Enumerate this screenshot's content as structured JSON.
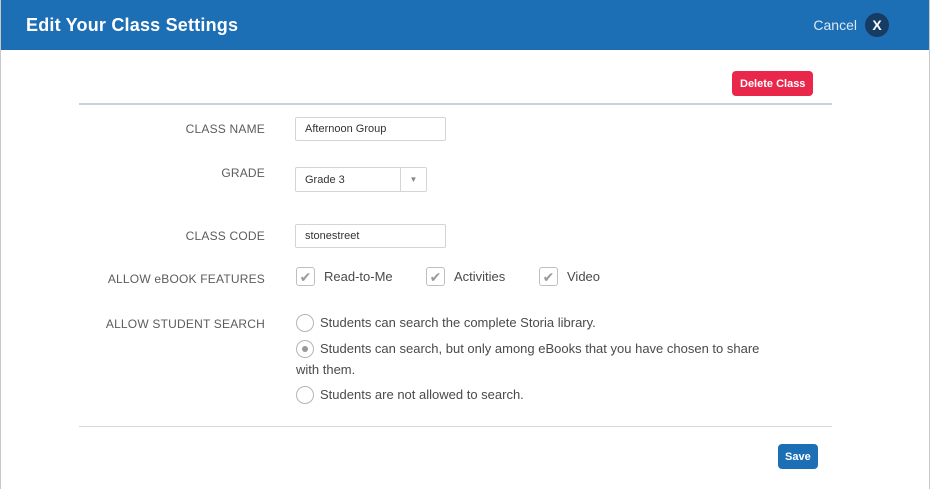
{
  "header": {
    "title": "Edit Your Class Settings",
    "cancel_label": "Cancel",
    "close_glyph": "X"
  },
  "actions": {
    "delete_label": "Delete Class",
    "save_label": "Save"
  },
  "form": {
    "class_name": {
      "label": "CLASS NAME",
      "value": "Afternoon Group"
    },
    "grade": {
      "label": "GRADE",
      "value": "Grade 3"
    },
    "class_code": {
      "label": "CLASS CODE",
      "value": "stonestreet"
    },
    "ebook_features": {
      "label": "ALLOW eBOOK FEATURES",
      "options": [
        {
          "label": "Read-to-Me",
          "checked": true
        },
        {
          "label": "Activities",
          "checked": true
        },
        {
          "label": "Video",
          "checked": true
        }
      ]
    },
    "student_search": {
      "label": "ALLOW STUDENT SEARCH",
      "options": [
        {
          "label": "Students can search the complete Storia library.",
          "selected": false
        },
        {
          "label": "Students can search, but only among eBooks that you have chosen to share",
          "label_cont": "with them.",
          "selected": true
        },
        {
          "label": "Students are not allowed to search.",
          "selected": false
        }
      ]
    }
  },
  "icons": {
    "close": "close-icon",
    "dropdown": "chevron-down-icon",
    "check": "check-icon"
  },
  "colors": {
    "header_bg": "#1c6fb5",
    "delete_bg": "#e8274b",
    "save_bg": "#1c6fb5"
  }
}
